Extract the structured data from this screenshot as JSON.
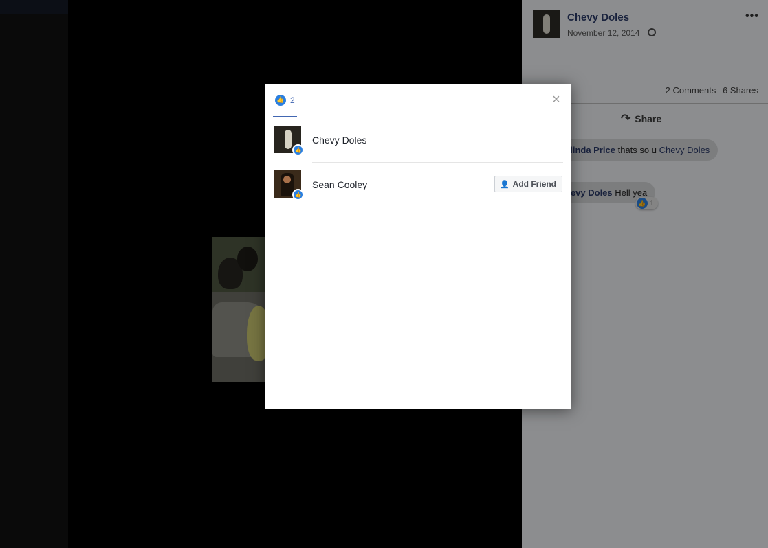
{
  "post": {
    "author": "Chevy Doles",
    "date": "November 12, 2014",
    "comments_count": "2 Comments",
    "shares_count": "6 Shares",
    "share_label": "Share",
    "comments": [
      {
        "author": "elinda Price",
        "text": "thats so u",
        "mention": "Chevy Doles"
      },
      {
        "author": "hevy Doles",
        "text": "Hell yea",
        "likes": "1"
      }
    ]
  },
  "modal": {
    "tab_count": "2",
    "close_label": "×",
    "reactors": [
      {
        "name": "Chevy Doles"
      },
      {
        "name": "Sean Cooley",
        "button": "Add Friend"
      }
    ]
  },
  "icons": {
    "like": "like-thumb-icon",
    "close": "close-icon",
    "share": "share-arrow-icon",
    "globe": "globe-icon",
    "more": "more-options-icon",
    "add_friend": "add-friend-icon"
  },
  "colors": {
    "accent": "#4267b2",
    "like_blue": "#2a7fe0",
    "name_blue": "#2b3a66"
  }
}
